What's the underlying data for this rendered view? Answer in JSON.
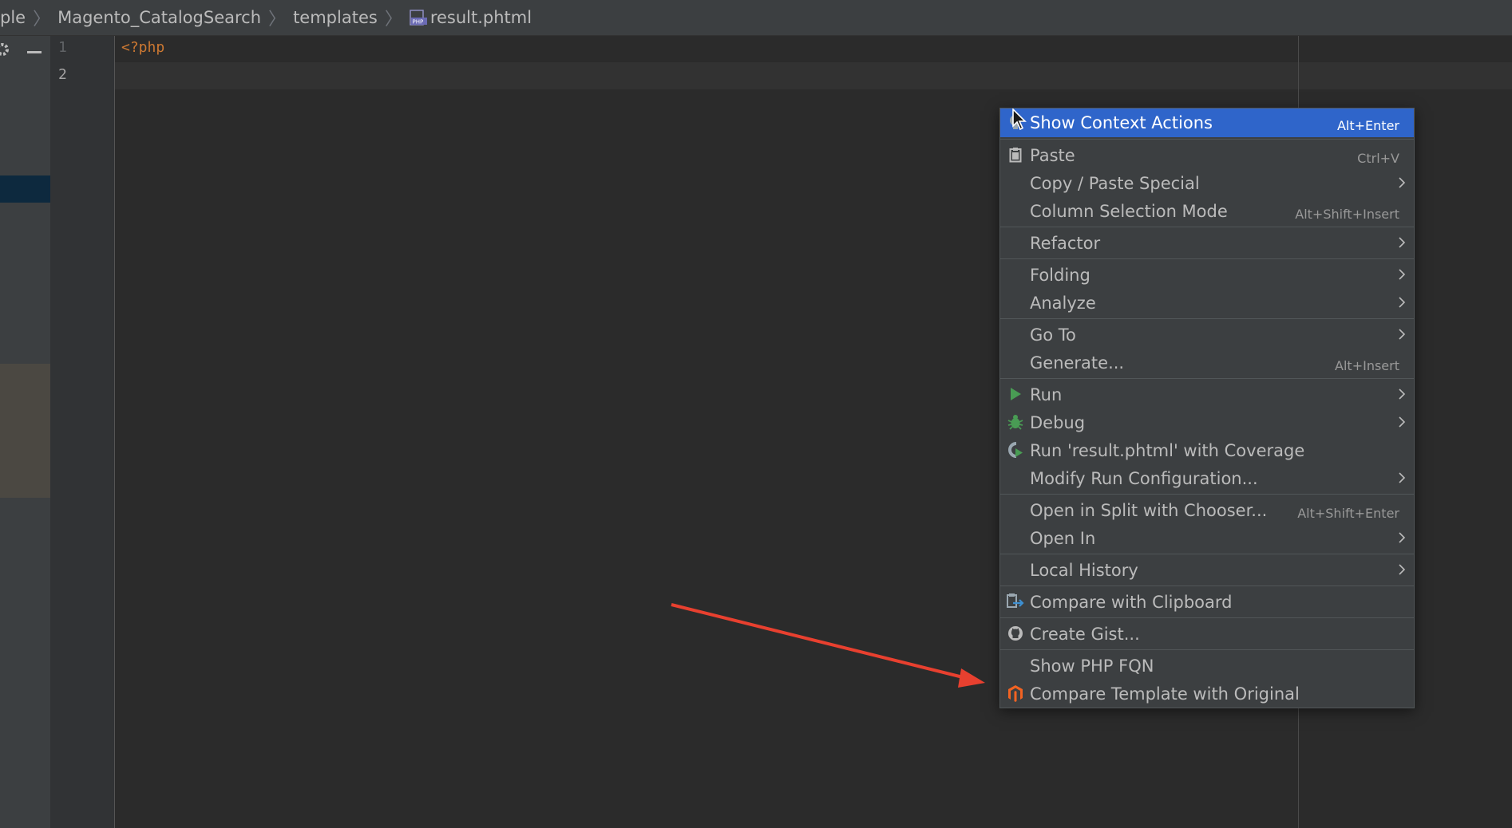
{
  "breadcrumb": {
    "items": [
      "ple",
      "Magento_CatalogSearch",
      "templates",
      "result.phtml"
    ],
    "file_icon": "php-file-icon"
  },
  "toolstrip": {
    "icons": [
      "gear-icon",
      "minus-icon"
    ]
  },
  "gutter": {
    "line_numbers": [
      "1",
      "2"
    ]
  },
  "editor": {
    "lines": [
      "<?php",
      ""
    ]
  },
  "context_menu": {
    "items": [
      {
        "label": "Show Context Actions",
        "shortcut": "Alt+Enter",
        "icon": "lightbulb-icon",
        "active": true
      },
      {
        "label": "Paste",
        "shortcut": "Ctrl+V",
        "icon": "clipboard-icon"
      },
      {
        "label": "Copy / Paste Special",
        "submenu": true
      },
      {
        "label": "Column Selection Mode",
        "shortcut": "Alt+Shift+Insert"
      },
      {
        "label": "Refactor",
        "submenu": true
      },
      {
        "label": "Folding",
        "submenu": true
      },
      {
        "label": "Analyze",
        "submenu": true
      },
      {
        "label": "Go To",
        "submenu": true
      },
      {
        "label": "Generate...",
        "shortcut": "Alt+Insert"
      },
      {
        "label": "Run",
        "icon": "run-icon",
        "submenu": true
      },
      {
        "label": "Debug",
        "icon": "debug-icon",
        "submenu": true
      },
      {
        "label": "Run 'result.phtml' with Coverage",
        "icon": "coverage-icon"
      },
      {
        "label": "Modify Run Configuration...",
        "submenu": true
      },
      {
        "label": "Open in Split with Chooser...",
        "shortcut": "Alt+Shift+Enter"
      },
      {
        "label": "Open In",
        "submenu": true
      },
      {
        "label": "Local History",
        "submenu": true
      },
      {
        "label": "Compare with Clipboard",
        "icon": "compare-icon"
      },
      {
        "label": "Create Gist...",
        "icon": "github-icon"
      },
      {
        "label": "Show PHP FQN"
      },
      {
        "label": "Compare Template with Original",
        "icon": "magento-icon"
      }
    ]
  },
  "annotation": {
    "color": "#e8402f",
    "icon": "red-arrow"
  },
  "colors": {
    "menu_active": "#2f65ca",
    "php_tag": "#cc7832",
    "run_green": "#499c54",
    "magento_orange": "#f26322"
  }
}
